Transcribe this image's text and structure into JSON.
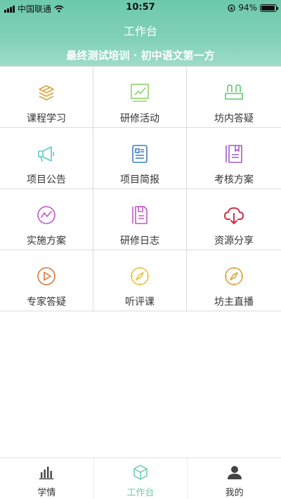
{
  "status_bar": {
    "carrier": "中国联通",
    "time": "10:57",
    "battery": "94%",
    "battery_level": 0.94
  },
  "header": {
    "title": "工作台",
    "subtitle": "最终测试培训 · 初中语文第一方"
  },
  "grid": {
    "items": [
      {
        "label": "课程学习",
        "icon": "box-stack-icon",
        "color": "#d9a441"
      },
      {
        "label": "研修活动",
        "icon": "chart-board-icon",
        "color": "#8fd36a"
      },
      {
        "label": "坊内答疑",
        "icon": "people-icon",
        "color": "#5cc86e"
      },
      {
        "label": "项目公告",
        "icon": "megaphone-icon",
        "color": "#5fc7cf"
      },
      {
        "label": "项目简报",
        "icon": "newspaper-icon",
        "color": "#3f7fc8"
      },
      {
        "label": "考核方案",
        "icon": "notebook-icon",
        "color": "#a05cc6"
      },
      {
        "label": "实施方案",
        "icon": "wave-circle-icon",
        "color": "#c158c6"
      },
      {
        "label": "研修日志",
        "icon": "journal-icon",
        "color": "#c158c6"
      },
      {
        "label": "资源分享",
        "icon": "cloud-download-icon",
        "color": "#c9344d"
      },
      {
        "label": "专家答疑",
        "icon": "play-circle-icon",
        "color": "#d9763a"
      },
      {
        "label": "听评课",
        "icon": "compass-icon",
        "color": "#e8c23c"
      },
      {
        "label": "坊主直播",
        "icon": "compass-icon",
        "color": "#d9a441"
      }
    ]
  },
  "tabbar": {
    "tabs": [
      {
        "label": "学情",
        "icon": "bar-chart-icon"
      },
      {
        "label": "工作台",
        "icon": "box-icon",
        "active": true
      },
      {
        "label": "我的",
        "icon": "user-icon"
      }
    ]
  },
  "colors": {
    "accent": "#6cc9ad"
  }
}
